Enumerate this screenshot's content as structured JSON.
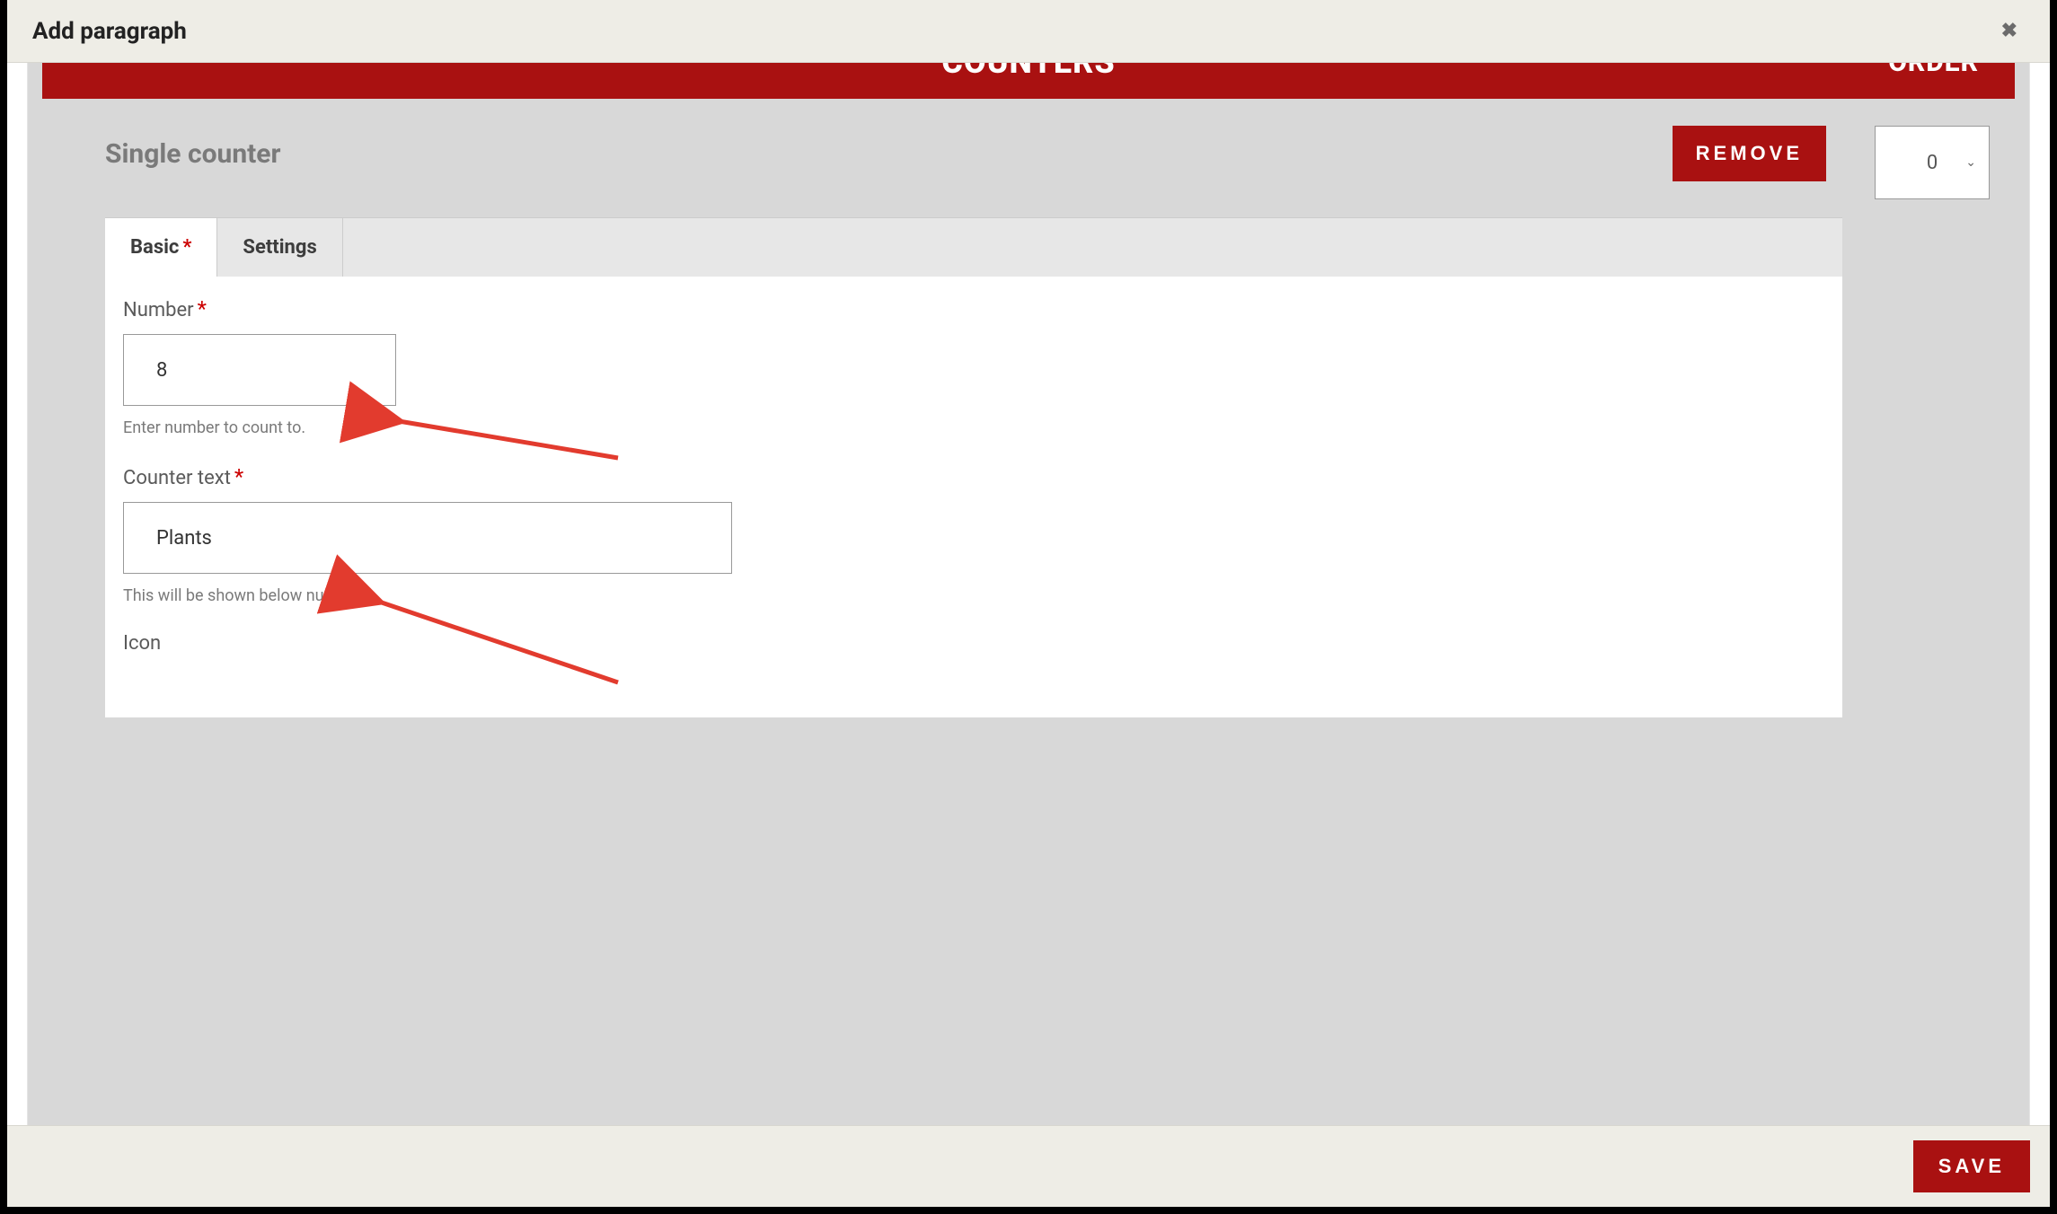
{
  "modal": {
    "title": "Add paragraph"
  },
  "banner": {
    "title": "COUNTERS",
    "order_label": "ORDER"
  },
  "counter": {
    "heading": "Single counter",
    "remove_label": "REMOVE",
    "order_value": "0"
  },
  "tabs": {
    "basic": "Basic",
    "settings": "Settings"
  },
  "fields": {
    "number": {
      "label": "Number",
      "value": "8",
      "help": "Enter number to count to."
    },
    "counter_text": {
      "label": "Counter text",
      "value": "Plants",
      "help": "This will be shown below number."
    },
    "icon": {
      "label": "Icon"
    }
  },
  "footer": {
    "save_label": "SAVE"
  }
}
